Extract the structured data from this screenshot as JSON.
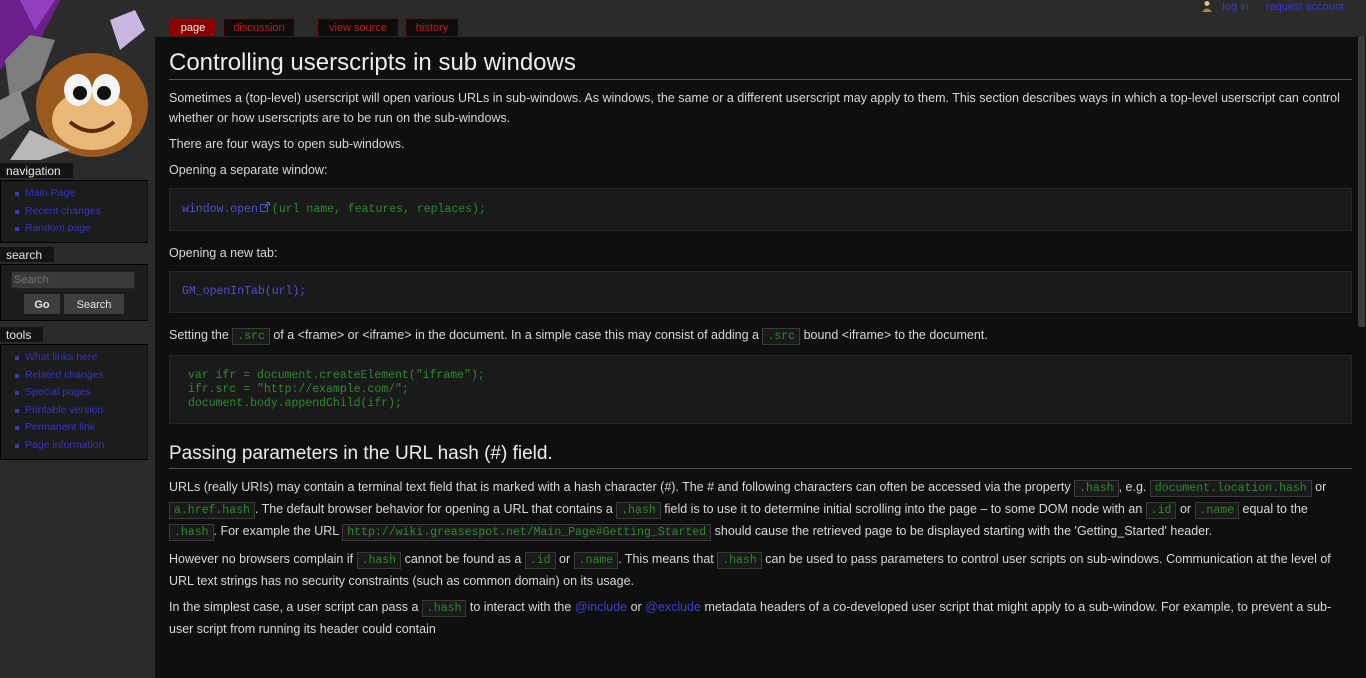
{
  "personal_tools": {
    "login": "log in",
    "request_account": "request account"
  },
  "tabs": [
    {
      "label": "page"
    },
    {
      "label": "discussion"
    },
    {
      "label": "view source"
    },
    {
      "label": "history"
    }
  ],
  "sidebar": {
    "navigation": {
      "title": "navigation",
      "items": [
        "Main Page",
        "Recent changes",
        "Random page"
      ]
    },
    "search": {
      "title": "search",
      "placeholder": "Search",
      "go_label": "Go",
      "search_label": "Search"
    },
    "tools": {
      "title": "tools",
      "items": [
        "What links here",
        "Related changes",
        "Special pages",
        "Printable version",
        "Permanent link",
        "Page information"
      ]
    }
  },
  "content": {
    "title": "Controlling userscripts in sub windows",
    "intro": "Sometimes a (top-level) userscript will open various URLs in sub-windows. As windows, the same or a different userscript may apply to them. This section describes ways in which a top-level userscript can control whether or how userscripts are to be run on the sub-windows.",
    "four_ways": "There are four ways to open sub-windows.",
    "separate_window_label": "Opening a separate window:",
    "code_window_open_fn": "window.open",
    "code_window_open_args": "(url name, features, replaces);",
    "new_tab_label": "Opening a new tab:",
    "code_new_tab": "GM_openInTab(url);",
    "setting_src": {
      "t1": "Setting the ",
      "c1": ".src",
      "t2": " of a <frame> or <iframe> in the document. In a simple case this may consist of adding a ",
      "c2": ".src",
      "t3": " bound <iframe> to the document."
    },
    "code_iframe": [
      "var ifr = document.createElement(\"iframe\");",
      "ifr.src = \"http://example.com/\";",
      "document.body.appendChild(ifr);"
    ],
    "section2_title": "Passing parameters in the URL hash (#) field.",
    "para1": {
      "t1": "URLs (really URIs) may contain a terminal text field that is marked with a hash character (#). The # and following characters can often be accessed via the property ",
      "c1": ".hash",
      "t2": ", e.g. ",
      "c2": "document.location.hash",
      "t3": " or ",
      "c3": "a.href.hash",
      "t4": ". The default browser behavior for opening a URL that contains a ",
      "c4": ".hash",
      "t5": " field is to use it to determine initial scrolling into the page – to some DOM node with an ",
      "c5": ".id",
      "t6": " or ",
      "c6": ".name",
      "t7": " equal to the ",
      "c7": ".hash",
      "t8": ". For example the URL ",
      "c8": "http://wiki.greasespot.net/Main_Page#Getting_Started",
      "t9": " should cause the retrieved page to be displayed starting with the 'Getting_Started' header."
    },
    "para2": {
      "t1": "However no browsers complain if ",
      "c1": ".hash",
      "t2": " cannot be found as a ",
      "c2": ".id",
      "t3": " or ",
      "c3": ".name",
      "t4": ". This means that ",
      "c4": ".hash",
      "t5": " can be used to pass parameters to control user scripts on sub-windows. Communication at the level of URL text strings has no security constraints (such as common domain) on its usage."
    },
    "para3": {
      "t1": "In the simplest case, a user script can pass a ",
      "c1": ".hash",
      "t2": " to interact with the ",
      "l1": "@include",
      "t3": " or ",
      "l2": "@exclude",
      "t4": " metadata headers of a co-developed user script that might apply to a sub-window. For example, to prevent a sub-user script from running its header could contain"
    }
  }
}
